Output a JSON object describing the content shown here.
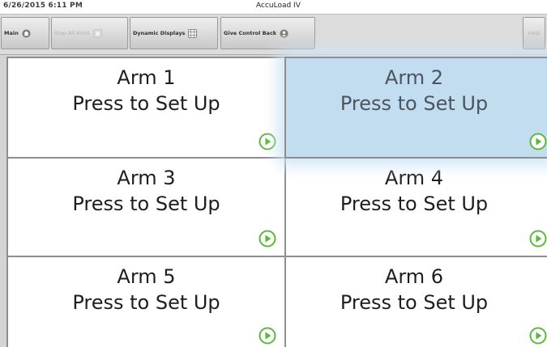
{
  "status_bar": {
    "datetime": "6/26/2015  6:11 PM",
    "title": "AccuLoad IV"
  },
  "toolbar": {
    "main_label": "Main",
    "main_icon": "home-icon",
    "stop_all_label": "Stop All Arms",
    "stop_all_icon": "stop-icon",
    "stop_all_enabled": false,
    "dynamic_label": "Dynamic Displays",
    "dynamic_icon": "grid-icon",
    "give_control_label": "Give Control Back",
    "give_control_icon": "user-icon",
    "help_label": "Help",
    "help_enabled": false
  },
  "arms": [
    {
      "name": "Arm 1",
      "action": "Press to Set Up",
      "selected": false
    },
    {
      "name": "Arm 2",
      "action": "Press to Set Up",
      "selected": true
    },
    {
      "name": "Arm 3",
      "action": "Press to Set Up",
      "selected": false
    },
    {
      "name": "Arm 4",
      "action": "Press to Set Up",
      "selected": false
    },
    {
      "name": "Arm 5",
      "action": "Press to Set Up",
      "selected": false
    },
    {
      "name": "Arm 6",
      "action": "Press to Set Up",
      "selected": false
    }
  ],
  "colors": {
    "go_icon": "#5cb83c",
    "selected_tile": "#c2dcf0"
  }
}
